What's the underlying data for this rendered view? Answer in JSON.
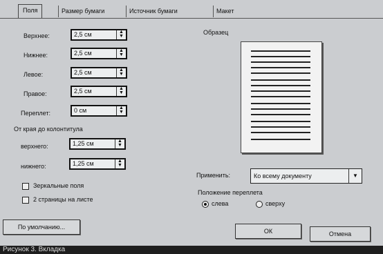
{
  "tabs": [
    {
      "label": "Поля"
    },
    {
      "label": "Размер бумаги"
    },
    {
      "label": "Источник бумаги"
    },
    {
      "label": "Макет"
    }
  ],
  "margins": [
    {
      "label": "Верхнее:",
      "value": "2,5 см"
    },
    {
      "label": "Нижнее:",
      "value": "2,5 см"
    },
    {
      "label": "Левое:",
      "value": "2,5 см"
    },
    {
      "label": "Правое:",
      "value": "2,5 см"
    },
    {
      "label": "Переплет:",
      "value": "0 см"
    }
  ],
  "header_footer": {
    "title": "От края до колонтитула",
    "fields": [
      {
        "label": "верхнего:",
        "value": "1,25 см"
      },
      {
        "label": "нижнего:",
        "value": "1,25 см"
      }
    ]
  },
  "checkboxes": [
    {
      "label": "Зеркальные поля",
      "checked": false
    },
    {
      "label": "2 страницы на листе",
      "checked": false
    }
  ],
  "preview": {
    "title": "Образец"
  },
  "apply": {
    "label": "Применить:",
    "value": "Ко всему документу"
  },
  "gutter_position": {
    "title": "Положение переплета",
    "options": [
      {
        "label": "слева",
        "selected": true
      },
      {
        "label": "сверху",
        "selected": false
      }
    ]
  },
  "buttons": {
    "default": "По умолчанию...",
    "ok": "ОК",
    "cancel": "Отмена"
  },
  "caption": "Рисунок 3. Вкладка"
}
